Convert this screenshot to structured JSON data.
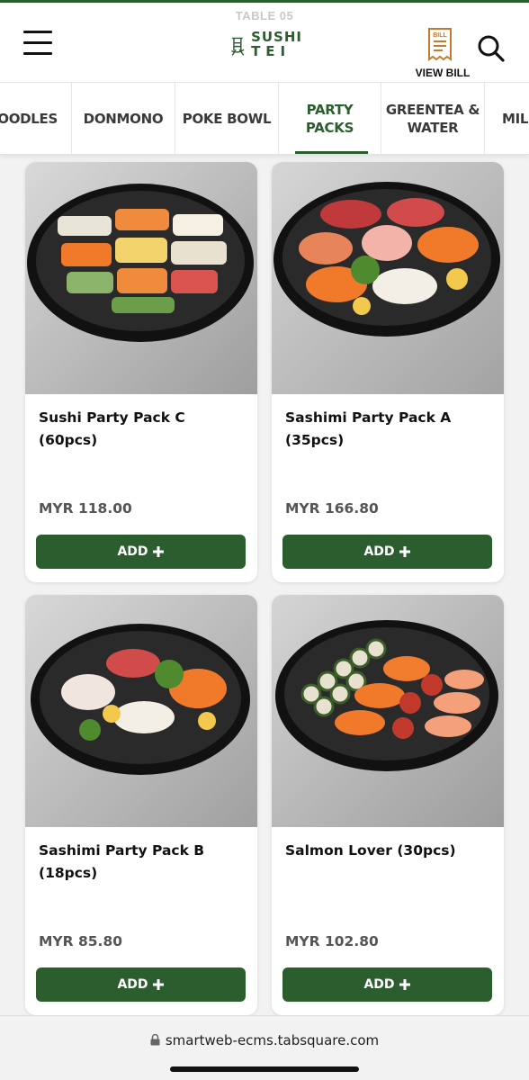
{
  "header": {
    "table_label": "TABLE 05",
    "logo_line1": "SUSHI",
    "logo_line2": "TEI",
    "bill_badge": "BILL",
    "bill_label": "VIEW BILL",
    "brand_color": "#2b5d2e"
  },
  "tabs": [
    {
      "label": "NOODLES",
      "active": false
    },
    {
      "label": "DONMONO",
      "active": false
    },
    {
      "label": "POKE BOWL",
      "active": false
    },
    {
      "label": "PARTY\nPACKS",
      "active": true
    },
    {
      "label": "GREENTEA &\nWATER",
      "active": false
    },
    {
      "label": "MILK",
      "active": false
    }
  ],
  "products": [
    {
      "name": "Sushi Party Pack C (60pcs)",
      "price": "MYR 118.00",
      "button": "ADD",
      "image_icon": "sushi-platter-image"
    },
    {
      "name": "Sashimi Party Pack A (35pcs)",
      "price": "MYR 166.80",
      "button": "ADD",
      "image_icon": "sashimi-platter-image"
    },
    {
      "name": "Sashimi Party Pack B (18pcs)",
      "price": "MYR 85.80",
      "button": "ADD",
      "image_icon": "sashimi-platter-image"
    },
    {
      "name": "Salmon Lover (30pcs)",
      "price": "MYR 102.80",
      "button": "ADD",
      "image_icon": "salmon-platter-image"
    }
  ],
  "browser": {
    "url": "smartweb-ecms.tabsquare.com"
  }
}
